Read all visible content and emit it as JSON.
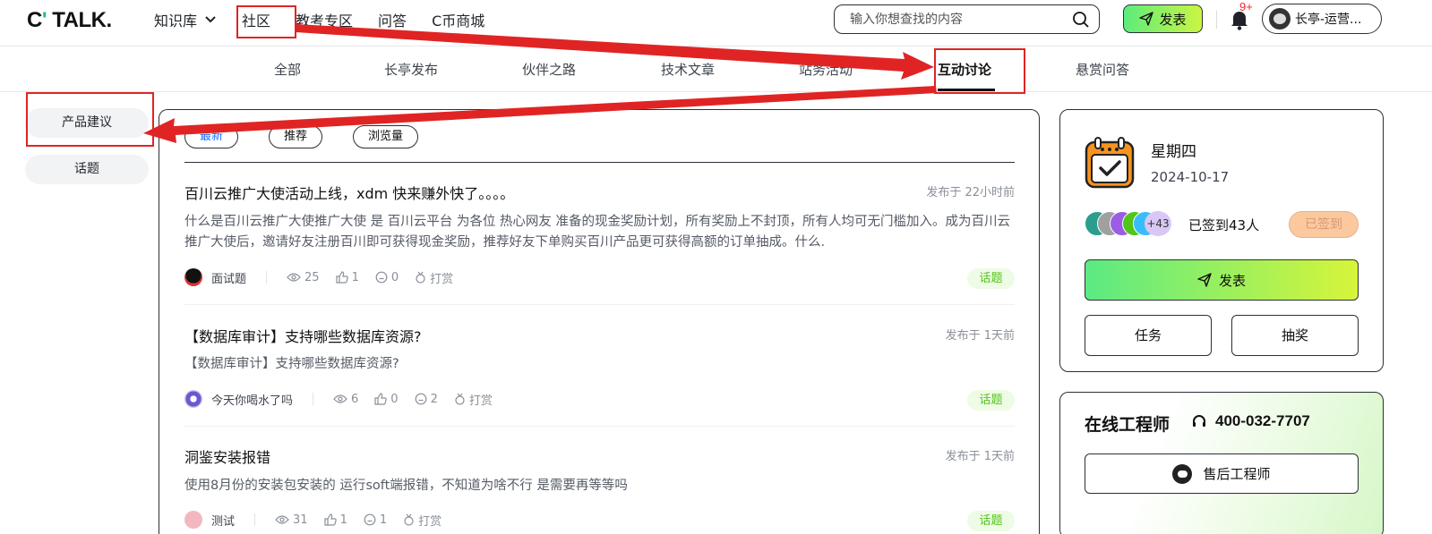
{
  "header": {
    "logo": "TALK.",
    "logo_prefix": "C",
    "nav": [
      {
        "label": "知识库",
        "dropdown": true
      },
      {
        "label": "社区"
      },
      {
        "label": "教考专区"
      },
      {
        "label": "问答"
      },
      {
        "label": "C币商城"
      }
    ],
    "search_placeholder": "输入你想查找的内容",
    "publish_label": "发表",
    "notification_badge": "9+",
    "user_name": "长亭-运营..."
  },
  "subnav": {
    "items": [
      "全部",
      "长亭发布",
      "伙伴之路",
      "技术文章",
      "站务活动",
      "互动讨论",
      "悬赏问答"
    ],
    "active": "互动讨论"
  },
  "sidebar": {
    "items": [
      "产品建议",
      "话题"
    ]
  },
  "feed": {
    "filters": [
      "最新",
      "推荐",
      "浏览量"
    ],
    "active_filter": "最新",
    "posts": [
      {
        "title": "百川云推广大使活动上线，xdm 快来赚外快了。。。。",
        "time": "发布于 22小时前",
        "excerpt": "什么是百川云推广大使推广大使 是 百川云平台 为各位 热心网友 准备的现金奖励计划，所有奖励上不封顶，所有人均可无门槛加入。成为百川云推广大使后，邀请好友注册百川即可获得现金奖励，推荐好友下单购买百川产品更可获得高额的订单抽成。什么.",
        "author": "面试题",
        "views": "25",
        "likes": "1",
        "comments": "0",
        "tip": "打赏",
        "tag": "话题"
      },
      {
        "title": "【数据库审计】支持哪些数据库资源?",
        "time": "发布于 1天前",
        "excerpt": "【数据库审计】支持哪些数据库资源?",
        "author": "今天你喝水了吗",
        "views": "6",
        "likes": "0",
        "comments": "2",
        "tip": "打赏",
        "tag": "话题"
      },
      {
        "title": "洞鉴安装报错",
        "time": "发布于 1天前",
        "excerpt": "使用8月份的安装包安装的 运行soft端报错，不知道为啥不行 是需要再等等吗",
        "author": "测试",
        "views": "31",
        "likes": "1",
        "comments": "1",
        "tip": "打赏",
        "tag": "话题"
      }
    ]
  },
  "checkin": {
    "weekday": "星期四",
    "date": "2024-10-17",
    "more_count": "+43",
    "signed_count": "已签到43人",
    "signed_button": "已签到",
    "publish_label": "发表",
    "task_label": "任务",
    "lottery_label": "抽奖"
  },
  "engineer": {
    "title": "在线工程师",
    "phone": "400-032-7707",
    "button_label": "售后工程师"
  },
  "colors": {
    "accent_blue": "#1f6fff",
    "tag_green": "#52c41a",
    "annotation_red": "#e02424",
    "gradient_start": "#5bea83",
    "gradient_end": "#d7f53a"
  }
}
